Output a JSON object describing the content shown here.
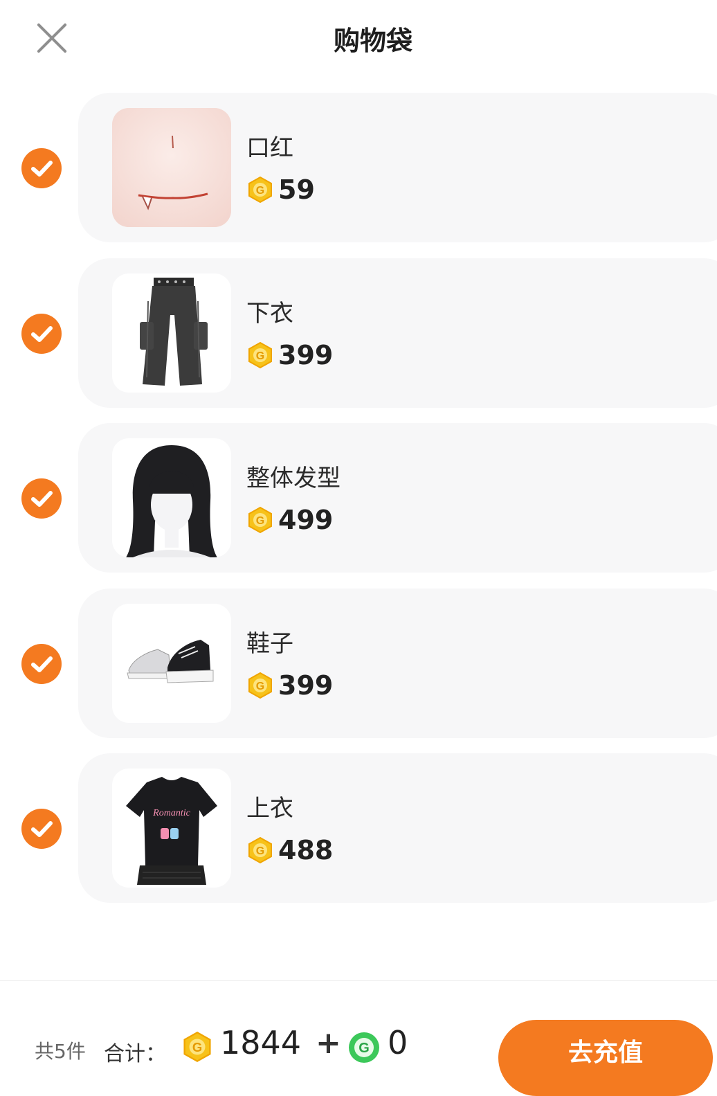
{
  "header": {
    "title": "购物袋"
  },
  "items": [
    {
      "name": "口红",
      "price": "59",
      "image": "lipstick-face",
      "checked": true
    },
    {
      "name": "下衣",
      "price": "399",
      "image": "black-cargo-pants",
      "checked": true
    },
    {
      "name": "整体发型",
      "price": "499",
      "image": "black-hairstyle",
      "checked": true
    },
    {
      "name": "鞋子",
      "price": "399",
      "image": "black-white-sneakers",
      "checked": true
    },
    {
      "name": "上衣",
      "price": "488",
      "image": "black-tshirt-with-skirt",
      "checked": true
    }
  ],
  "footer": {
    "count_label": "共5件",
    "total_label": "合计：",
    "gold_total": "1844",
    "plus": "+",
    "green_total": "0",
    "action_label": "去充值"
  },
  "colors": {
    "accent": "#f47a20",
    "card_bg": "#f7f7f8",
    "coin_gold": "#f7c21a",
    "coin_green": "#3cc85a"
  },
  "icons": {
    "close": "close-icon",
    "check": "check-icon",
    "gold_coin": "gold-coin-icon",
    "green_coin": "green-coin-icon"
  }
}
